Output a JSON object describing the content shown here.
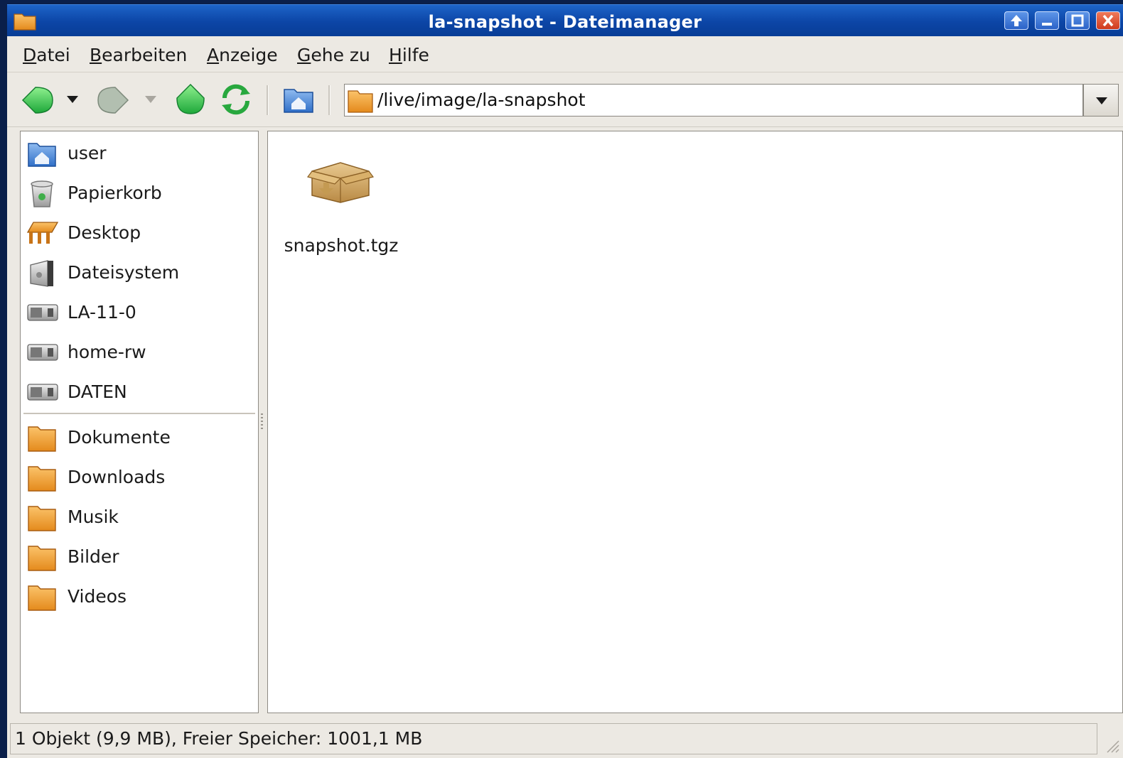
{
  "window": {
    "title": "la-snapshot - Dateimanager"
  },
  "menu": [
    {
      "accel": "D",
      "rest": "atei"
    },
    {
      "accel": "B",
      "rest": "earbeiten"
    },
    {
      "accel": "A",
      "rest": "nzeige"
    },
    {
      "accel": "G",
      "rest": "ehe zu"
    },
    {
      "accel": "H",
      "rest": "ilfe"
    }
  ],
  "toolbar": {
    "icons": [
      "back-icon",
      "dropdown-arrow-icon",
      "forward-icon",
      "dropdown-arrow-icon",
      "up-icon",
      "reload-icon",
      "home-icon"
    ],
    "location": "/live/image/la-snapshot"
  },
  "sidebar": {
    "places": [
      {
        "label": "user",
        "icon": "home-folder-icon"
      },
      {
        "label": "Papierkorb",
        "icon": "trash-icon"
      },
      {
        "label": "Desktop",
        "icon": "desktop-icon"
      },
      {
        "label": "Dateisystem",
        "icon": "filesystem-icon"
      },
      {
        "label": "LA-11-0",
        "icon": "drive-icon"
      },
      {
        "label": "home-rw",
        "icon": "drive-icon"
      },
      {
        "label": "DATEN",
        "icon": "drive-icon"
      }
    ],
    "bookmarks": [
      {
        "label": "Dokumente",
        "icon": "folder-icon"
      },
      {
        "label": "Downloads",
        "icon": "folder-icon"
      },
      {
        "label": "Musik",
        "icon": "folder-icon"
      },
      {
        "label": "Bilder",
        "icon": "folder-icon"
      },
      {
        "label": "Videos",
        "icon": "folder-icon"
      }
    ]
  },
  "files": [
    {
      "name": "snapshot.tgz",
      "icon": "archive-icon"
    }
  ],
  "status": "1 Objekt (9,9 MB), Freier Speicher: 1001,1 MB",
  "colors": {
    "titlebar": "#0c45a6",
    "window_bg": "#ece9e3",
    "folder": "#f0a030",
    "nav_green": "#2fb84a"
  }
}
